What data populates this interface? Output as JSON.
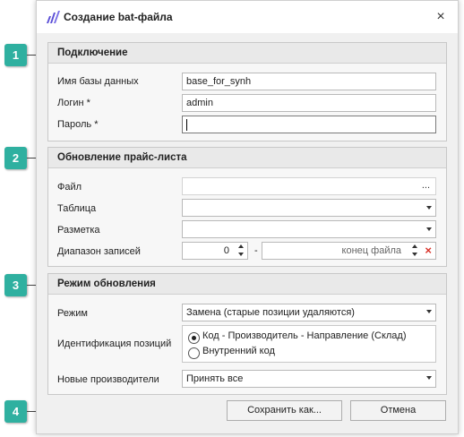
{
  "window": {
    "title": "Создание bat-файла",
    "close_glyph": "×"
  },
  "section1": {
    "header": "Подключение",
    "db_label": "Имя базы данных",
    "db_value": "base_for_synh",
    "login_label": "Логин *",
    "login_value": "admin",
    "password_label": "Пароль *",
    "password_value": ""
  },
  "section2": {
    "header": "Обновление прайс-листа",
    "file_label": "Файл",
    "file_button": "...",
    "table_label": "Таблица",
    "markup_label": "Разметка",
    "range_label": "Диапазон записей",
    "range_start": "0",
    "range_dash": "-",
    "range_end_placeholder": "конец файла",
    "clear_glyph": "×"
  },
  "section3": {
    "header": "Режим обновления",
    "mode_label": "Режим",
    "mode_value": "Замена (старые позиции удаляются)",
    "ident_label": "Идентификация позиций",
    "ident_options": [
      {
        "label": "Код - Производитель - Направление (Склад)",
        "checked": true
      },
      {
        "label": "Внутренний код",
        "checked": false
      }
    ],
    "new_makers_label": "Новые производители",
    "new_makers_value": "Принять все"
  },
  "buttons": {
    "save_as": "Сохранить как...",
    "cancel": "Отмена"
  },
  "callouts": [
    "1",
    "2",
    "3",
    "4"
  ],
  "colors": {
    "callout": "#2fb0a0",
    "clear_icon": "#d9342b",
    "app_icon": "#5b4fd6"
  }
}
